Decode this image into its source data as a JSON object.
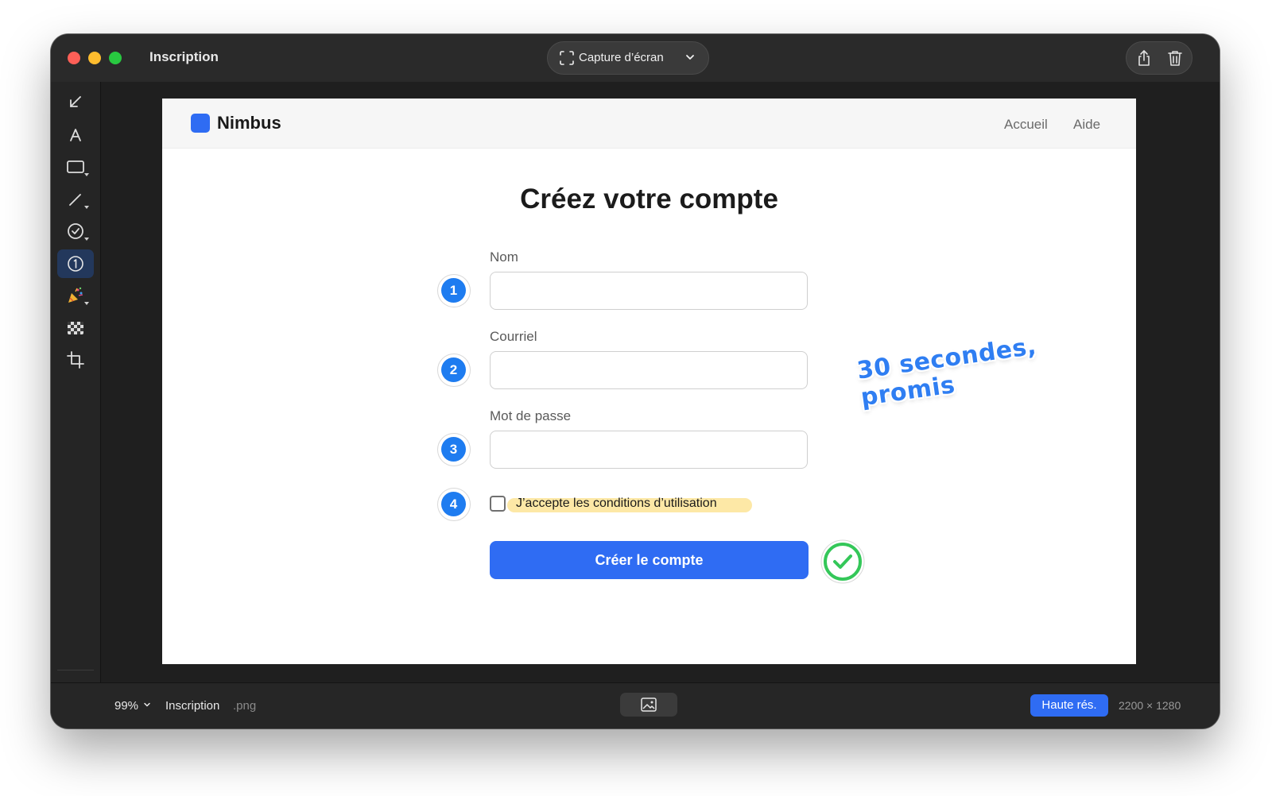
{
  "window": {
    "title": "Inscription",
    "capture_label": "Capture d’écran"
  },
  "tools": [
    {
      "name": "arrow-tool",
      "icon": "arrow-down-left-icon"
    },
    {
      "name": "text-tool",
      "label": "A",
      "icon": "text-icon"
    },
    {
      "name": "rectangle-tool",
      "icon": "rectangle-icon"
    },
    {
      "name": "pen-tool",
      "icon": "pen-icon"
    },
    {
      "name": "checkmark-tool",
      "icon": "checkmark-circle-icon"
    },
    {
      "name": "counter-tool",
      "icon": "numbered-circle-icon",
      "active": true
    },
    {
      "name": "confetti-tool",
      "icon": "party-popper-icon"
    },
    {
      "name": "pixelate-tool",
      "icon": "checker-icon"
    },
    {
      "name": "crop-tool",
      "icon": "crop-icon"
    }
  ],
  "colors": {
    "accent": "#2f6cf3",
    "active_color": "#ea3a33",
    "badge_blue": "#1e7cf0",
    "success_green": "#34c759",
    "highlight_yellow": "#fde8a6"
  },
  "site": {
    "brand": "Nimbus",
    "nav": [
      "Accueil",
      "Aide"
    ],
    "title": "Créez votre compte",
    "fields": [
      {
        "label": "Nom",
        "value": "",
        "badge": "1"
      },
      {
        "label": "Courriel",
        "value": "",
        "badge": "2"
      },
      {
        "label": "Mot de passe",
        "value": "",
        "badge": "3"
      }
    ],
    "checkbox": {
      "label": "J’accepte les conditions d’utilisation",
      "badge": "4",
      "checked": false
    },
    "submit_label": "Créer le compte"
  },
  "annotations": {
    "sticker_line1": "30 secondes,",
    "sticker_line2": "promis"
  },
  "bottombar": {
    "zoom": "99%",
    "filename": "Inscription",
    "extension": ".png",
    "hires_label": "Haute rés.",
    "dimensions": "2200 × 1280"
  }
}
